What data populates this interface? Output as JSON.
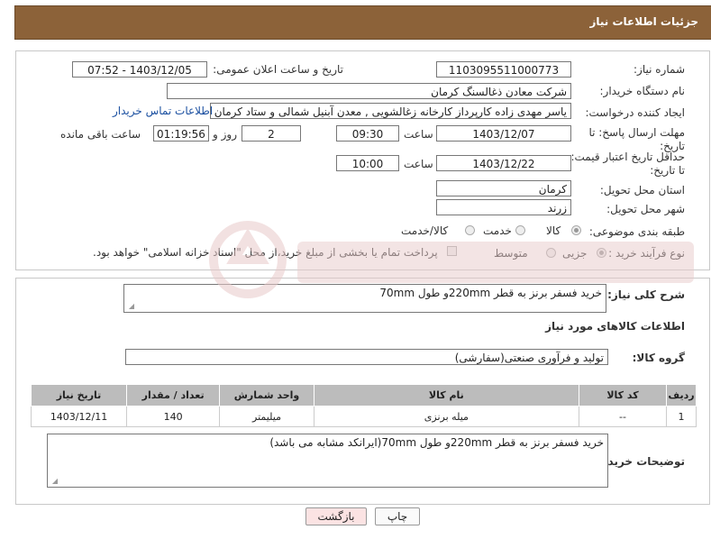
{
  "header": {
    "title": "جزئیات اطلاعات نیاز"
  },
  "form": {
    "need_number_label": "شماره نیاز:",
    "need_number": "1103095511000773",
    "announce_label": "تاریخ و ساعت اعلان عمومی:",
    "announce_value": "1403/12/05 - 07:52",
    "buyer_org_label": "نام دستگاه خریدار:",
    "buyer_org": "شرکت معادن ذغالسنگ کرمان",
    "creator_label": "ایجاد کننده درخواست:",
    "creator": "یاسر مهدی زاده کارپرداز کارخانه زغالشویی , معدن آبنیل شمالی و ستاد کرمان , شرکت معادن ذغالسنگ کرمان",
    "contact_link": "اطلاعات تماس خریدار",
    "deadline_label": "مهلت ارسال پاسخ: تا تاریخ:",
    "deadline_date": "1403/12/07",
    "time_label": "ساعت",
    "deadline_time": "09:30",
    "days_value": "2",
    "days_label": "روز و",
    "remaining_value": "01:19:56",
    "remaining_label": "ساعت باقی مانده",
    "min_price_label": "حداقل تاریخ اعتبار قیمت: تا تاریخ:",
    "min_price_date": "1403/12/22",
    "min_price_time": "10:00",
    "province_label": "استان محل تحویل:",
    "province": "کرمان",
    "city_label": "شهر محل تحویل:",
    "city": "زرند",
    "category_label": "طبقه بندی موضوعی:",
    "category_options": [
      "کالا",
      "خدمت",
      "کالا/خدمت"
    ],
    "process_label": "نوع فرآیند خرید :",
    "process_options": [
      "جزیی",
      "متوسط"
    ],
    "payment_note": "پرداخت تمام یا بخشی از مبلغ خرید،از محل \"اسناد خزانه اسلامی\" خواهد بود."
  },
  "details": {
    "summary_label": "شرح کلی نیاز:",
    "summary": "خرید فسفر برنز به قطر 220mmو طول 70mm",
    "goods_info_title": "اطلاعات کالاهای مورد نیاز",
    "goods_group_label": "گروه کالا:",
    "goods_group": "تولید و فرآوری صنعتی(سفارشی)",
    "table": {
      "headers": [
        "ردیف",
        "کد کالا",
        "نام کالا",
        "واحد شمارش",
        "تعداد / مقدار",
        "تاریخ نیاز"
      ],
      "rows": [
        [
          "1",
          "--",
          "میله برنزی",
          "میلیمتر",
          "140",
          "1403/12/11"
        ]
      ]
    },
    "buyer_notes_label": "توضیحات خریدار:",
    "buyer_notes": "خرید فسفر برنز به قطر 220mmو طول 70mm(ایرانکد مشابه می باشد)"
  },
  "buttons": {
    "print": "چاپ",
    "back": "بازگشت"
  },
  "colors": {
    "header_bg": "#8c6239",
    "table_header_bg": "#bcbcbc",
    "back_button_bg": "#fbe3e3"
  }
}
